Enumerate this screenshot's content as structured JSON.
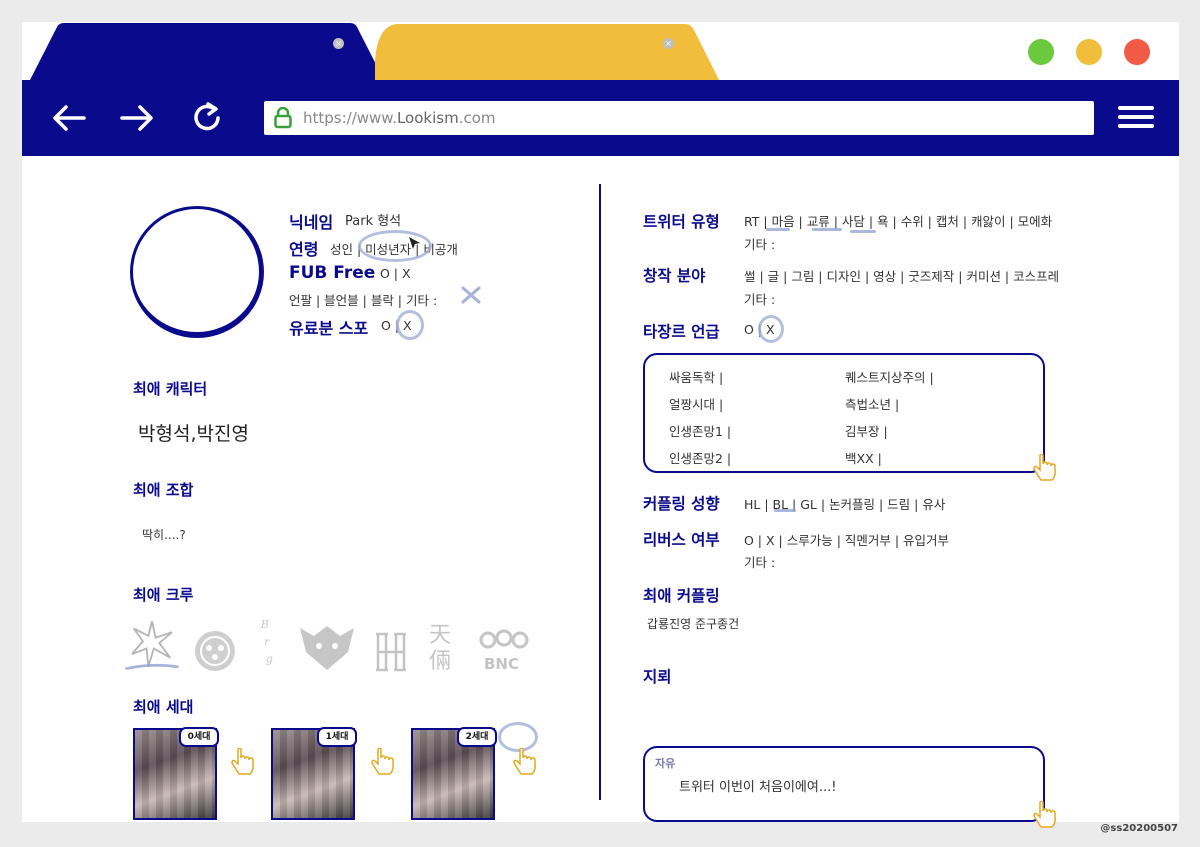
{
  "browser": {
    "url_prefix": "https://www.",
    "url_domain": "Lookism",
    "url_suffix": ".com",
    "tab1_color": "#0a0a8c",
    "tab2_color": "#f0bd3c",
    "traffic_colors": [
      "#6cc83c",
      "#f0bd3c",
      "#f05a46"
    ]
  },
  "profile": {
    "nickname_label": "닉네임",
    "nickname_value": "Park 형석",
    "age_label": "연령",
    "age_options": "성인 | 미성년자 | 비공개",
    "fub_label": "FUB Free",
    "fub_value": "O | X",
    "fub_detail": "언팔 | 블언블 | 블락 | 기타 :",
    "spoiler_label": "유료분 스포",
    "spoiler_value": "O | X"
  },
  "favorite_character": {
    "label": "최애 캐릭터",
    "value": "박형석,박진영"
  },
  "favorite_combo": {
    "label": "최애 조합",
    "value": "딱히....?"
  },
  "favorite_crew": {
    "label": "최애 크루",
    "logos": [
      "crew-logo-1",
      "crew-logo-2",
      "crew-logo-3",
      "crew-logo-4",
      "crew-logo-5",
      "crew-logo-6",
      "crew-logo-7"
    ],
    "bnc_text": "BNC"
  },
  "favorite_generation": {
    "label": "최애 세대",
    "cards": [
      "0세대",
      "1세대",
      "2세대"
    ]
  },
  "twitter_type": {
    "label": "트위터 유형",
    "options": "RT | 마음 | 교류 | 사담 | 욕 | 수위 | 캡처 | 캐앓이 | 모에화",
    "other": "기타 :"
  },
  "creation": {
    "label": "창작 분야",
    "options": "썰 | 글 | 그림 | 디자인 | 영상 | 굿즈제작 | 커미션 | 코스프레",
    "other": "기타 :"
  },
  "other_genre": {
    "label": "타장르 언급",
    "value": "O | X",
    "items": [
      "싸움독학 |",
      "퀘스트지상주의 |",
      "얼짱시대 |",
      "측법소년 |",
      "인생존망1 |",
      "김부장 |",
      "인생존망2 |",
      "백XX |"
    ]
  },
  "coupling": {
    "label": "커플링 성향",
    "options": "HL | BL | GL | 논커플링 | 드림 | 유사"
  },
  "reverse": {
    "label": "리버스 여부",
    "options": "O | X | 스루가능 | 직멘거부 | 유입거부",
    "other": "기타 :"
  },
  "fav_coupling": {
    "label": "최애 커플링",
    "value": "갑룡진영 준구종건"
  },
  "landmine": {
    "label": "지뢰"
  },
  "free": {
    "label": "자유",
    "value": "트위터 이번이 처음이에여...!"
  },
  "credit": "@ss20200507"
}
